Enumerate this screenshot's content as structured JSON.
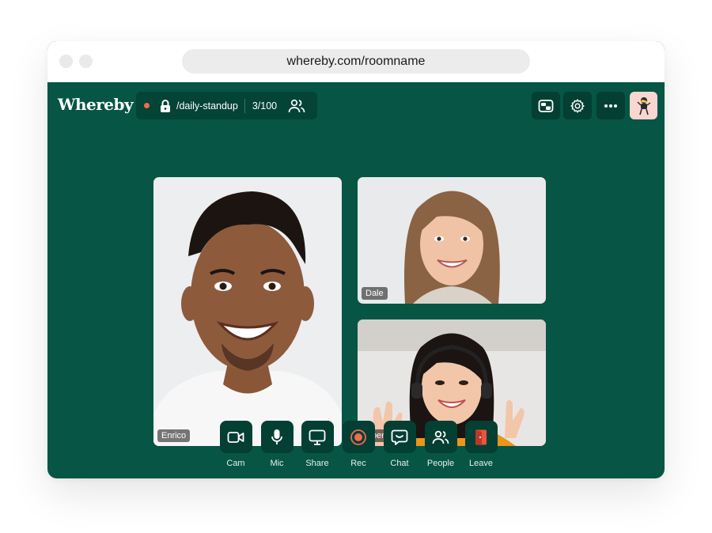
{
  "browser": {
    "url": "whereby.com/roomname"
  },
  "app": {
    "logo": "Whereby",
    "room": {
      "name": "/daily-standup",
      "count": "3/100"
    },
    "colors": {
      "background": "#065545",
      "button": "#033f33",
      "accent": "#f06b4f",
      "avatar_bg": "#f9d6cf"
    },
    "top_icons": [
      "picture-in-picture-icon",
      "settings-gear-icon",
      "more-options-icon"
    ]
  },
  "participants": [
    {
      "name": "Enrico"
    },
    {
      "name": "Dale"
    },
    {
      "name": "Noemi"
    }
  ],
  "controls": [
    {
      "label": "Cam",
      "icon": "camera-icon"
    },
    {
      "label": "Mic",
      "icon": "microphone-icon"
    },
    {
      "label": "Share",
      "icon": "screen-share-icon"
    },
    {
      "label": "Rec",
      "icon": "record-icon"
    },
    {
      "label": "Chat",
      "icon": "chat-icon"
    },
    {
      "label": "People",
      "icon": "people-icon"
    },
    {
      "label": "Leave",
      "icon": "leave-door-icon"
    }
  ]
}
